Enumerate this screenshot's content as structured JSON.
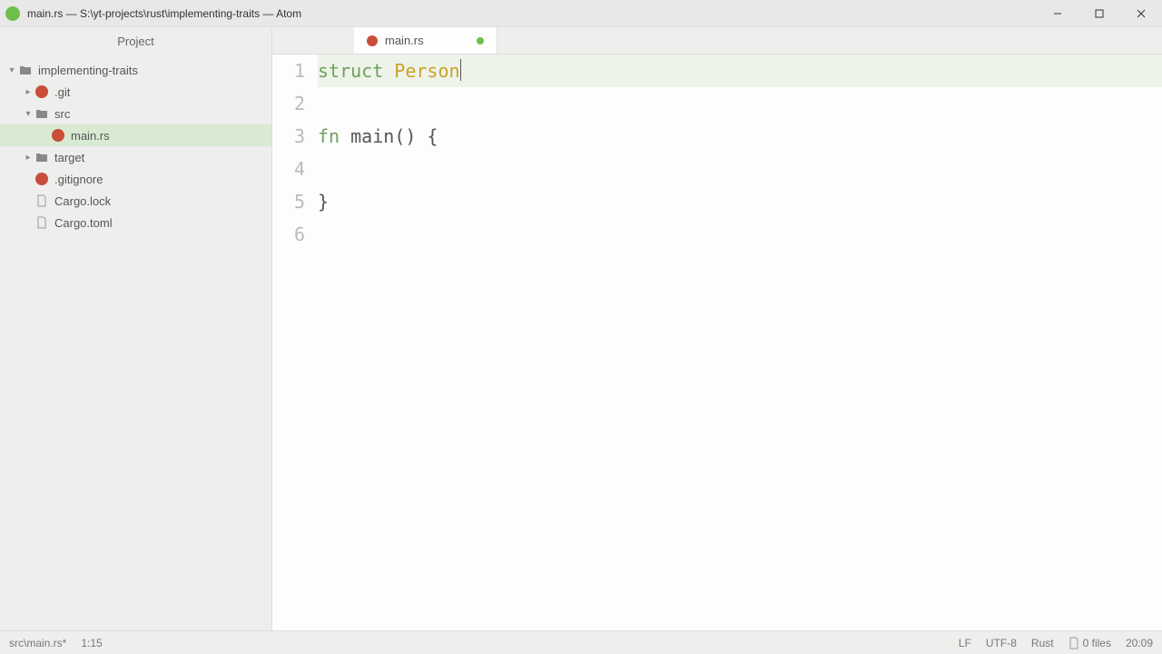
{
  "window": {
    "title": "main.rs — S:\\yt-projects\\rust\\implementing-traits — Atom"
  },
  "sidebar": {
    "header": "Project",
    "tree": {
      "root": "implementing-traits",
      "git": ".git",
      "src": "src",
      "mainrs": "main.rs",
      "target": "target",
      "gitignore": ".gitignore",
      "cargolock": "Cargo.lock",
      "cargotoml": "Cargo.toml"
    }
  },
  "tabs": {
    "tab1": "main.rs"
  },
  "code": {
    "line1_kw": "struct",
    "line1_type": "Person",
    "line3_kw": "fn",
    "line3_fn": "main",
    "line3_rest": "() {",
    "line5": "}",
    "line_numbers": [
      "1",
      "2",
      "3",
      "4",
      "5",
      "6"
    ]
  },
  "status": {
    "path": "src\\main.rs*",
    "cursor": "1:15",
    "lf": "LF",
    "encoding": "UTF-8",
    "lang": "Rust",
    "files": "0 files",
    "time": "20:09"
  }
}
